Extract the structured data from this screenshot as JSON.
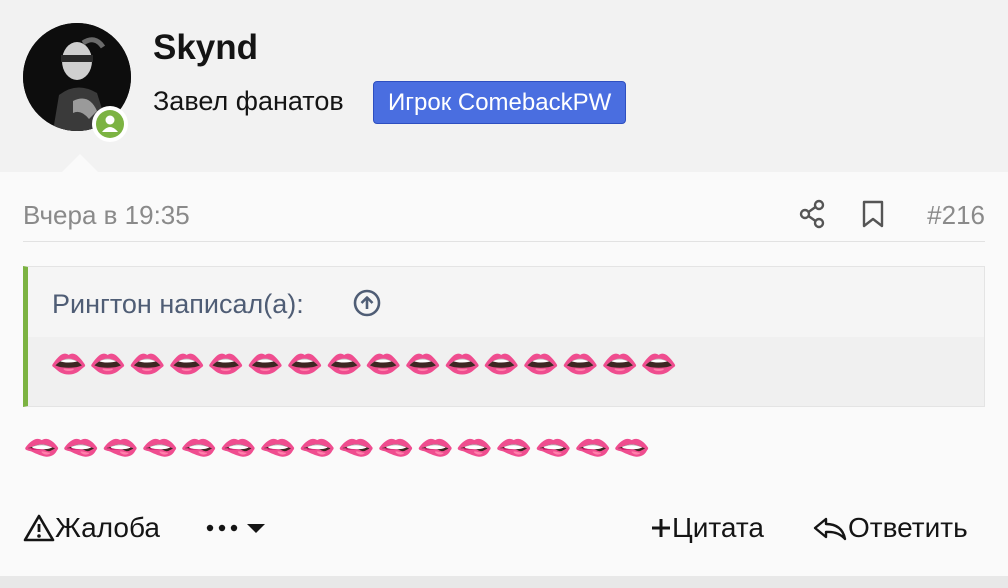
{
  "user": {
    "name": "Skynd",
    "title": "Завел фанатов",
    "banner": "Игрок ComebackPW",
    "avatar_icon": "avatar-photo",
    "online_status_icon": "online-user-icon",
    "online_color": "#7cb342"
  },
  "post": {
    "date": "Вчера в 19:35",
    "number": "#216",
    "quote": {
      "author_line": "Рингтон написал(а):",
      "content": "👄👄👄👄👄👄👄👄👄👄👄👄👄👄👄👄",
      "accent_color": "#7cb342"
    },
    "content": "🫦🫦🫦🫦🫦🫦🫦🫦🫦🫦🫦🫦🫦🫦🫦🫦"
  },
  "actions": {
    "report": "Жалоба",
    "quote": "Цитата",
    "reply": "Ответить"
  },
  "colors": {
    "banner_bg": "#4a6ee0",
    "meta_text": "#8a8a8a",
    "quote_author": "#4f5d75"
  }
}
